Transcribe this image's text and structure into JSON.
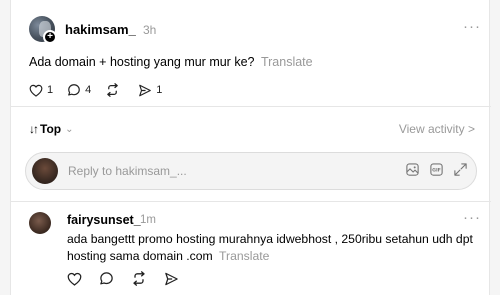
{
  "post": {
    "username": "hakimsam_",
    "time": "3h",
    "text": "Ada domain + hosting yang mur mur ke?",
    "translate": "Translate",
    "more": "···",
    "actions": {
      "like_count": "1",
      "comment_count": "4",
      "repost_count": "",
      "share_count": "1"
    }
  },
  "sort": {
    "label": "Top",
    "view_activity": "View activity >"
  },
  "reply": {
    "placeholder": "Reply to hakimsam_..."
  },
  "comment": {
    "username": "fairysunset_",
    "time": "1m",
    "text": "ada bangettt promo hosting murahnya idwebhost , 250ribu setahun udh dpt hosting sama domain .com",
    "translate": "Translate",
    "more": "···"
  }
}
